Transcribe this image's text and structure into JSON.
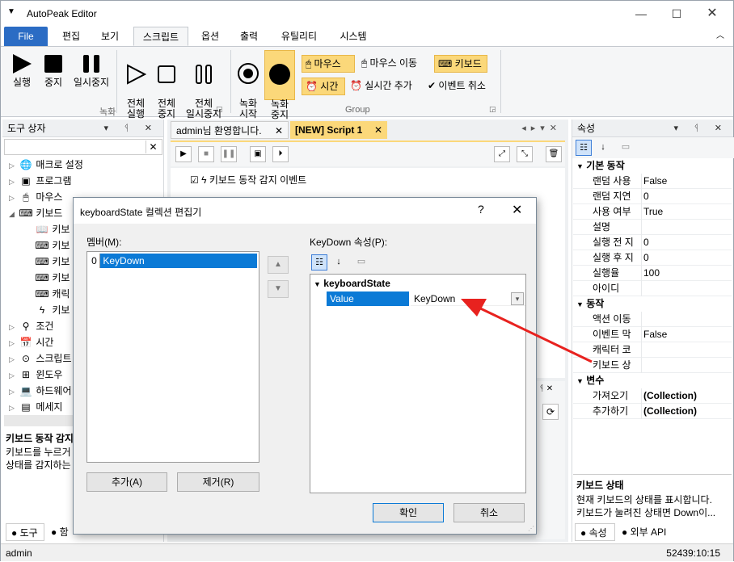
{
  "app": {
    "title": "AutoPeak Editor"
  },
  "menu": {
    "file": "File",
    "items": [
      "편집",
      "보기",
      "스크립트",
      "옵션",
      "출력",
      "유틸리티",
      "시스템"
    ]
  },
  "ribbon": {
    "run": "실행",
    "stop": "중지",
    "pause": "일시중지",
    "run_all": "전체\n실행",
    "stop_all": "전체\n중지",
    "pause_all": "전체\n일시중지",
    "rec_start": "녹화\n시작",
    "rec_stop": "녹화\n중지",
    "mouse": "마우스",
    "mouse_move": "마우스 이동",
    "keyboard": "키보드",
    "time": "시간",
    "realtime_add": "실시간 추가",
    "event_cancel": "이벤트 취소",
    "group_record": "녹화",
    "group_group": "Group"
  },
  "toolbox": {
    "title": "도구 상자",
    "items": [
      "매크로 설정",
      "프로그램",
      "마우스",
      "키보드",
      "키보",
      "키보",
      "키보",
      "키보",
      "캐릭",
      "키보",
      "조건",
      "시간",
      "스크립트",
      "윈도우",
      "하드웨어",
      "메세지"
    ],
    "desc_title": "키보드 동작 감지",
    "desc_text": "키보드를 누르거\n상태를 감지하는",
    "tab_tools": "도구",
    "tab_func": "함"
  },
  "doc_tabs": {
    "welcome": "admin님 환영합니다.",
    "script": "[NEW] Script 1"
  },
  "script": {
    "event_line": "키보드 동작 감지 이벤트"
  },
  "properties": {
    "title": "속성",
    "cat_basic": "기본 동작",
    "rows_basic": [
      {
        "name": "랜덤 사용",
        "value": "False"
      },
      {
        "name": "랜덤 지연",
        "value": "0"
      },
      {
        "name": "사용 여부",
        "value": "True"
      },
      {
        "name": "설명",
        "value": ""
      },
      {
        "name": "실행 전 지",
        "value": "0"
      },
      {
        "name": "실행 후 지",
        "value": "0"
      },
      {
        "name": "실행율",
        "value": "100"
      },
      {
        "name": "아이디",
        "value": ""
      }
    ],
    "cat_action": "동작",
    "rows_action": [
      {
        "name": "액션 이동",
        "value": ""
      },
      {
        "name": "이벤트 막",
        "value": "False"
      },
      {
        "name": "캐릭터 코",
        "value": ""
      },
      {
        "name": "키보드 상",
        "value": ""
      }
    ],
    "cat_var": "변수",
    "rows_var": [
      {
        "name": "가져오기",
        "value": "(Collection)"
      },
      {
        "name": "추가하기",
        "value": "(Collection)"
      }
    ],
    "desc_title": "키보드 상태",
    "desc_text1": "현재 키보드의 상태를 표시합니다.",
    "desc_text2": "키보드가 눌려진 상태면 Down이...",
    "tab_props": "속성",
    "tab_api": "외부 API"
  },
  "dialog": {
    "title": "keyboardState 컬렉션 편집기",
    "help": "?",
    "members_label": "멤버(M):",
    "member_index": "0",
    "member_name": "KeyDown",
    "props_label": "KeyDown 속성(P):",
    "category": "keyboardState",
    "prop_name": "Value",
    "prop_value": "KeyDown",
    "add": "추가(A)",
    "remove": "제거(R)",
    "ok": "확인",
    "cancel": "취소"
  },
  "status": {
    "user": "admin",
    "clock": "52439:10:15"
  },
  "colors": {
    "accent": "#2b6cc4",
    "highlight": "#fbd87a",
    "selection": "#0b7ad6",
    "arrow": "#e8221f"
  }
}
